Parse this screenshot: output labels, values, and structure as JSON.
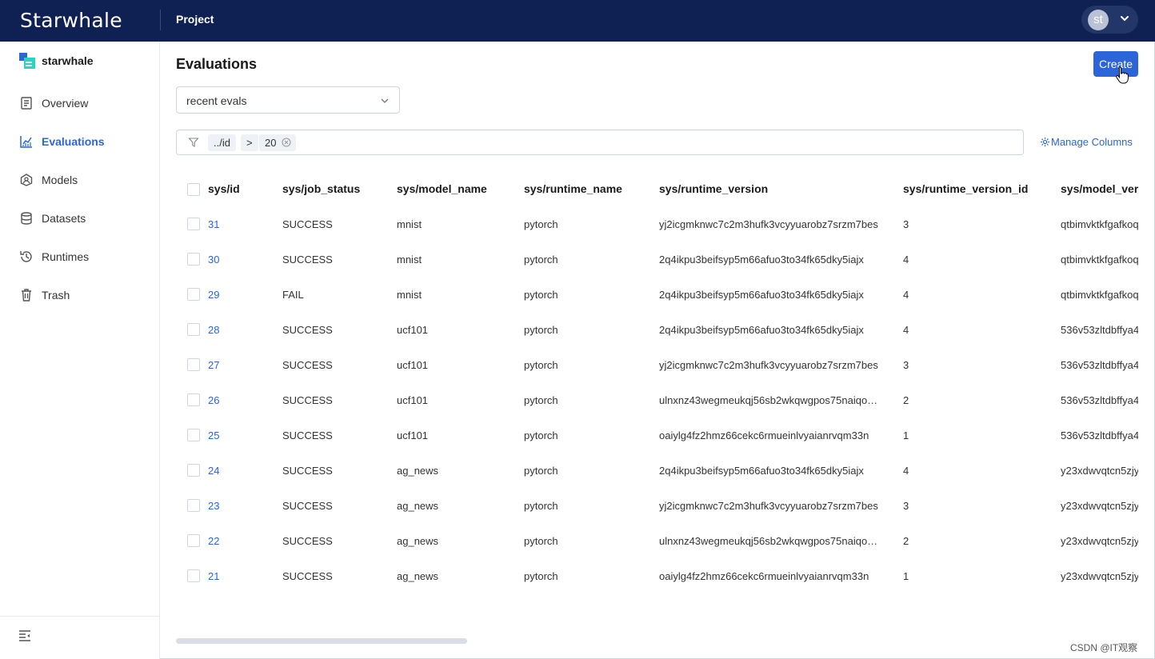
{
  "header": {
    "logo": "Starwhale",
    "project_label": "Project",
    "user_initials": "st"
  },
  "sidebar": {
    "brand": "starwhale",
    "items": [
      {
        "label": "Overview",
        "icon": "document-icon",
        "active": false
      },
      {
        "label": "Evaluations",
        "icon": "chart-icon",
        "active": true
      },
      {
        "label": "Models",
        "icon": "model-icon",
        "active": false
      },
      {
        "label": "Datasets",
        "icon": "database-icon",
        "active": false
      },
      {
        "label": "Runtimes",
        "icon": "runtime-icon",
        "active": false
      },
      {
        "label": "Trash",
        "icon": "trash-icon",
        "active": false
      }
    ]
  },
  "main": {
    "title": "Evaluations",
    "create_label": "Create",
    "view_select": "recent evals",
    "filter": {
      "field": "../id",
      "operator": ">",
      "value": "20"
    },
    "manage_columns_label": "Manage Columns"
  },
  "table": {
    "columns": [
      "sys/id",
      "sys/job_status",
      "sys/model_name",
      "sys/runtime_name",
      "sys/runtime_version",
      "sys/runtime_version_id",
      "sys/model_version"
    ],
    "rows": [
      [
        "31",
        "SUCCESS",
        "mnist",
        "pytorch",
        "yj2icgmknwc7c2m3hufk3vcyyuarobz7srzm7bes",
        "3",
        "qtbimvktkfgafkoq"
      ],
      [
        "30",
        "SUCCESS",
        "mnist",
        "pytorch",
        "2q4ikpu3beifsyp5m66afuo3to34fk65dky5iajx",
        "4",
        "qtbimvktkfgafkoq"
      ],
      [
        "29",
        "FAIL",
        "mnist",
        "pytorch",
        "2q4ikpu3beifsyp5m66afuo3to34fk65dky5iajx",
        "4",
        "qtbimvktkfgafkoq"
      ],
      [
        "28",
        "SUCCESS",
        "ucf101",
        "pytorch",
        "2q4ikpu3beifsyp5m66afuo3to34fk65dky5iajx",
        "4",
        "536v53zltdbffya4"
      ],
      [
        "27",
        "SUCCESS",
        "ucf101",
        "pytorch",
        "yj2icgmknwc7c2m3hufk3vcyyuarobz7srzm7bes",
        "3",
        "536v53zltdbffya4"
      ],
      [
        "26",
        "SUCCESS",
        "ucf101",
        "pytorch",
        "ulnxnz43wegmeukqj56sb2wkqwgpos75naiqo…",
        "2",
        "536v53zltdbffya4"
      ],
      [
        "25",
        "SUCCESS",
        "ucf101",
        "pytorch",
        "oaiylg4fz2hmz66cekc6rmueinlvyaianrvqm33n",
        "1",
        "536v53zltdbffya4"
      ],
      [
        "24",
        "SUCCESS",
        "ag_news",
        "pytorch",
        "2q4ikpu3beifsyp5m66afuo3to34fk65dky5iajx",
        "4",
        "y23xdwvqtcn5zjy"
      ],
      [
        "23",
        "SUCCESS",
        "ag_news",
        "pytorch",
        "yj2icgmknwc7c2m3hufk3vcyyuarobz7srzm7bes",
        "3",
        "y23xdwvqtcn5zjy"
      ],
      [
        "22",
        "SUCCESS",
        "ag_news",
        "pytorch",
        "ulnxnz43wegmeukqj56sb2wkqwgpos75naiqo…",
        "2",
        "y23xdwvqtcn5zjy"
      ],
      [
        "21",
        "SUCCESS",
        "ag_news",
        "pytorch",
        "oaiylg4fz2hmz66cekc6rmueinlvyaianrvqm33n",
        "1",
        "y23xdwvqtcn5zjy"
      ]
    ]
  },
  "watermark": "CSDN @IT观察",
  "colors": {
    "header_bg": "#0f2152",
    "accent": "#2b65d9"
  }
}
